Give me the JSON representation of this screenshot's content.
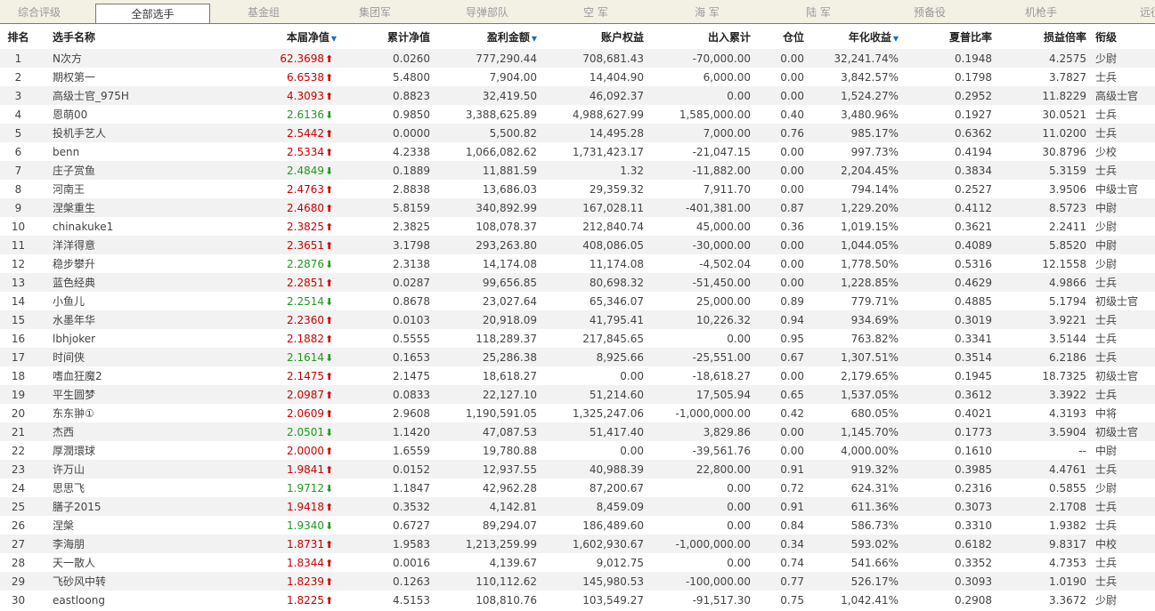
{
  "colors": {
    "up": "#cc0000",
    "down": "#1e9a1e",
    "sort": "#1a6fc4"
  },
  "tabs": [
    {
      "label": "综合评级",
      "active": false
    },
    {
      "label": "全部选手",
      "active": true
    },
    {
      "label": "基金组",
      "active": false
    },
    {
      "label": "集团军",
      "active": false
    },
    {
      "label": "导弹部队",
      "active": false
    },
    {
      "label": "空 军",
      "active": false
    },
    {
      "label": "海 军",
      "active": false
    },
    {
      "label": "陆 军",
      "active": false
    },
    {
      "label": "预备役",
      "active": false
    },
    {
      "label": "机枪手",
      "active": false
    },
    {
      "label": "远征",
      "active": false
    }
  ],
  "table": {
    "headers": {
      "rank": "排名",
      "name": "选手名称",
      "current_nav": "本届净值",
      "cum_nav": "累计净值",
      "profit": "盈利金额",
      "equity": "账户权益",
      "flow": "出入累计",
      "position": "仓位",
      "annual": "年化收益",
      "sharpe": "夏普比率",
      "plr": "损益倍率",
      "rank_title": "衔级"
    },
    "sort_icon": "▼",
    "rows": [
      {
        "rank": "1",
        "name": "N次方",
        "nav": "62.3698",
        "dir": "up",
        "cum": "0.0260",
        "profit": "777,290.44",
        "equity": "708,681.43",
        "flow": "-70,000.00",
        "pos": "0.00",
        "annual": "32,241.74%",
        "sharpe": "0.1948",
        "plr": "4.2575",
        "title": "少尉"
      },
      {
        "rank": "2",
        "name": "期权第一",
        "nav": "6.6538",
        "dir": "up",
        "cum": "5.4800",
        "profit": "7,904.00",
        "equity": "14,404.90",
        "flow": "6,000.00",
        "pos": "0.00",
        "annual": "3,842.57%",
        "sharpe": "0.1798",
        "plr": "3.7827",
        "title": "士兵"
      },
      {
        "rank": "3",
        "name": "高级士官_975H",
        "nav": "4.3093",
        "dir": "up",
        "cum": "0.8823",
        "profit": "32,419.50",
        "equity": "46,092.37",
        "flow": "0.00",
        "pos": "0.00",
        "annual": "1,524.27%",
        "sharpe": "0.2952",
        "plr": "11.8229",
        "title": "高级士官"
      },
      {
        "rank": "4",
        "name": "恩萌00",
        "nav": "2.6136",
        "dir": "down",
        "cum": "0.9850",
        "profit": "3,388,625.89",
        "equity": "4,988,627.99",
        "flow": "1,585,000.00",
        "pos": "0.40",
        "annual": "3,480.96%",
        "sharpe": "0.1927",
        "plr": "30.0521",
        "title": "士兵"
      },
      {
        "rank": "5",
        "name": "投机手艺人",
        "nav": "2.5442",
        "dir": "up",
        "cum": "0.0000",
        "profit": "5,500.82",
        "equity": "14,495.28",
        "flow": "7,000.00",
        "pos": "0.76",
        "annual": "985.17%",
        "sharpe": "0.6362",
        "plr": "11.0200",
        "title": "士兵"
      },
      {
        "rank": "6",
        "name": "benn",
        "nav": "2.5334",
        "dir": "up",
        "cum": "4.2338",
        "profit": "1,066,082.62",
        "equity": "1,731,423.17",
        "flow": "-21,047.15",
        "pos": "0.00",
        "annual": "997.73%",
        "sharpe": "0.4194",
        "plr": "30.8796",
        "title": "少校"
      },
      {
        "rank": "7",
        "name": "庄子赏鱼",
        "nav": "2.4849",
        "dir": "down",
        "cum": "0.1889",
        "profit": "11,881.59",
        "equity": "1.32",
        "flow": "-11,882.00",
        "pos": "0.00",
        "annual": "2,204.45%",
        "sharpe": "0.3834",
        "plr": "5.3159",
        "title": "士兵"
      },
      {
        "rank": "8",
        "name": "河南王",
        "nav": "2.4763",
        "dir": "up",
        "cum": "2.8838",
        "profit": "13,686.03",
        "equity": "29,359.32",
        "flow": "7,911.70",
        "pos": "0.00",
        "annual": "794.14%",
        "sharpe": "0.2527",
        "plr": "3.9506",
        "title": "中级士官"
      },
      {
        "rank": "9",
        "name": "涅槃重生",
        "nav": "2.4680",
        "dir": "up",
        "cum": "5.8159",
        "profit": "340,892.99",
        "equity": "167,028.11",
        "flow": "-401,381.00",
        "pos": "0.87",
        "annual": "1,229.20%",
        "sharpe": "0.4112",
        "plr": "8.5723",
        "title": "中尉"
      },
      {
        "rank": "10",
        "name": "chinakuke1",
        "nav": "2.3825",
        "dir": "up",
        "cum": "2.3825",
        "profit": "108,078.37",
        "equity": "212,840.74",
        "flow": "45,000.00",
        "pos": "0.36",
        "annual": "1,019.15%",
        "sharpe": "0.3621",
        "plr": "2.2411",
        "title": "少尉"
      },
      {
        "rank": "11",
        "name": "洋洋得意",
        "nav": "2.3651",
        "dir": "up",
        "cum": "3.1798",
        "profit": "293,263.80",
        "equity": "408,086.05",
        "flow": "-30,000.00",
        "pos": "0.00",
        "annual": "1,044.05%",
        "sharpe": "0.4089",
        "plr": "5.8520",
        "title": "中尉"
      },
      {
        "rank": "12",
        "name": "稳步攀升",
        "nav": "2.2876",
        "dir": "down",
        "cum": "2.3138",
        "profit": "14,174.08",
        "equity": "11,174.08",
        "flow": "-4,502.04",
        "pos": "0.00",
        "annual": "1,778.50%",
        "sharpe": "0.5316",
        "plr": "12.1558",
        "title": "少尉"
      },
      {
        "rank": "13",
        "name": "蓝色经典",
        "nav": "2.2851",
        "dir": "up",
        "cum": "0.0287",
        "profit": "99,656.85",
        "equity": "80,698.32",
        "flow": "-51,450.00",
        "pos": "0.00",
        "annual": "1,228.85%",
        "sharpe": "0.4629",
        "plr": "4.9866",
        "title": "士兵"
      },
      {
        "rank": "14",
        "name": "小鱼儿",
        "nav": "2.2514",
        "dir": "down",
        "cum": "0.8678",
        "profit": "23,027.64",
        "equity": "65,346.07",
        "flow": "25,000.00",
        "pos": "0.89",
        "annual": "779.71%",
        "sharpe": "0.4885",
        "plr": "5.1794",
        "title": "初级士官"
      },
      {
        "rank": "15",
        "name": "水墨年华",
        "nav": "2.2360",
        "dir": "up",
        "cum": "0.0103",
        "profit": "20,918.09",
        "equity": "41,795.41",
        "flow": "10,226.32",
        "pos": "0.94",
        "annual": "934.69%",
        "sharpe": "0.3019",
        "plr": "3.9221",
        "title": "士兵"
      },
      {
        "rank": "16",
        "name": "lbhjoker",
        "nav": "2.1882",
        "dir": "up",
        "cum": "0.5555",
        "profit": "118,289.37",
        "equity": "217,845.65",
        "flow": "0.00",
        "pos": "0.95",
        "annual": "763.82%",
        "sharpe": "0.3341",
        "plr": "3.5144",
        "title": "士兵"
      },
      {
        "rank": "17",
        "name": "时间侠",
        "nav": "2.1614",
        "dir": "down",
        "cum": "0.1653",
        "profit": "25,286.38",
        "equity": "8,925.66",
        "flow": "-25,551.00",
        "pos": "0.67",
        "annual": "1,307.51%",
        "sharpe": "0.3514",
        "plr": "6.2186",
        "title": "士兵"
      },
      {
        "rank": "18",
        "name": "嗜血狂魔2",
        "nav": "2.1475",
        "dir": "up",
        "cum": "2.1475",
        "profit": "18,618.27",
        "equity": "0.00",
        "flow": "-18,618.27",
        "pos": "0.00",
        "annual": "2,179.65%",
        "sharpe": "0.1945",
        "plr": "18.7325",
        "title": "初级士官"
      },
      {
        "rank": "19",
        "name": "平生圆梦",
        "nav": "2.0987",
        "dir": "up",
        "cum": "0.0833",
        "profit": "22,127.10",
        "equity": "51,214.60",
        "flow": "17,505.94",
        "pos": "0.65",
        "annual": "1,537.05%",
        "sharpe": "0.3612",
        "plr": "3.3922",
        "title": "士兵"
      },
      {
        "rank": "20",
        "name": "东东翀①",
        "nav": "2.0609",
        "dir": "up",
        "cum": "2.9608",
        "profit": "1,190,591.05",
        "equity": "1,325,247.06",
        "flow": "-1,000,000.00",
        "pos": "0.42",
        "annual": "680.05%",
        "sharpe": "0.4021",
        "plr": "4.3193",
        "title": "中将"
      },
      {
        "rank": "21",
        "name": "杰西",
        "nav": "2.0501",
        "dir": "down",
        "cum": "1.1420",
        "profit": "47,087.53",
        "equity": "51,417.40",
        "flow": "3,829.86",
        "pos": "0.00",
        "annual": "1,145.70%",
        "sharpe": "0.1773",
        "plr": "3.5904",
        "title": "初级士官"
      },
      {
        "rank": "22",
        "name": "厚潤環球",
        "nav": "2.0000",
        "dir": "up",
        "cum": "1.6559",
        "profit": "19,780.88",
        "equity": "0.00",
        "flow": "-39,561.76",
        "pos": "0.00",
        "annual": "4,000.00%",
        "sharpe": "0.1610",
        "plr": "--",
        "title": "中尉"
      },
      {
        "rank": "23",
        "name": "许万山",
        "nav": "1.9841",
        "dir": "up",
        "cum": "0.0152",
        "profit": "12,937.55",
        "equity": "40,988.39",
        "flow": "22,800.00",
        "pos": "0.91",
        "annual": "919.32%",
        "sharpe": "0.3985",
        "plr": "4.4761",
        "title": "士兵"
      },
      {
        "rank": "24",
        "name": "思思飞",
        "nav": "1.9712",
        "dir": "down",
        "cum": "1.1847",
        "profit": "42,962.28",
        "equity": "87,200.67",
        "flow": "0.00",
        "pos": "0.72",
        "annual": "624.31%",
        "sharpe": "0.2316",
        "plr": "0.5855",
        "title": "少尉"
      },
      {
        "rank": "25",
        "name": "膳子2015",
        "nav": "1.9418",
        "dir": "up",
        "cum": "0.3532",
        "profit": "4,142.81",
        "equity": "8,459.09",
        "flow": "0.00",
        "pos": "0.91",
        "annual": "611.36%",
        "sharpe": "0.3073",
        "plr": "2.1708",
        "title": "士兵"
      },
      {
        "rank": "26",
        "name": "涅槃",
        "nav": "1.9340",
        "dir": "down",
        "cum": "0.6727",
        "profit": "89,294.07",
        "equity": "186,489.60",
        "flow": "0.00",
        "pos": "0.84",
        "annual": "586.73%",
        "sharpe": "0.3310",
        "plr": "1.9382",
        "title": "士兵"
      },
      {
        "rank": "27",
        "name": "李海朋",
        "nav": "1.8731",
        "dir": "up",
        "cum": "1.9583",
        "profit": "1,213,259.99",
        "equity": "1,602,930.67",
        "flow": "-1,000,000.00",
        "pos": "0.34",
        "annual": "593.02%",
        "sharpe": "0.6182",
        "plr": "9.8317",
        "title": "中校"
      },
      {
        "rank": "28",
        "name": "天一散人",
        "nav": "1.8344",
        "dir": "up",
        "cum": "0.0016",
        "profit": "4,139.67",
        "equity": "9,012.75",
        "flow": "0.00",
        "pos": "0.74",
        "annual": "541.66%",
        "sharpe": "0.3352",
        "plr": "4.7353",
        "title": "士兵"
      },
      {
        "rank": "29",
        "name": "飞砂风中转",
        "nav": "1.8239",
        "dir": "up",
        "cum": "0.1263",
        "profit": "110,112.62",
        "equity": "145,980.53",
        "flow": "-100,000.00",
        "pos": "0.77",
        "annual": "526.17%",
        "sharpe": "0.3093",
        "plr": "1.0190",
        "title": "士兵"
      },
      {
        "rank": "30",
        "name": "eastloong",
        "nav": "1.8225",
        "dir": "up",
        "cum": "4.5153",
        "profit": "108,810.76",
        "equity": "103,549.27",
        "flow": "-91,517.30",
        "pos": "0.75",
        "annual": "1,042.41%",
        "sharpe": "0.2908",
        "plr": "3.3672",
        "title": "少尉"
      }
    ]
  }
}
